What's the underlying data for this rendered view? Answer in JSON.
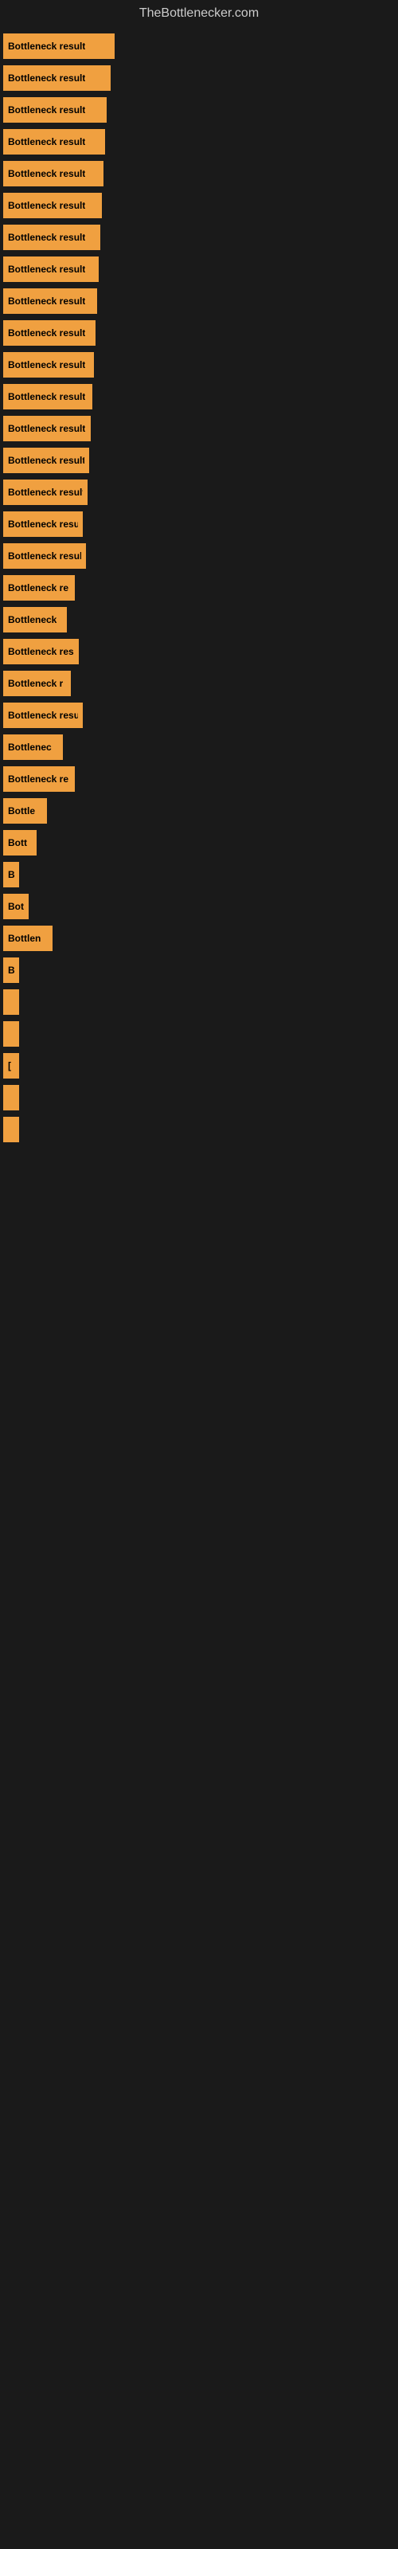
{
  "site": {
    "title": "TheBottlenecker.com"
  },
  "bars": [
    {
      "label": "Bottleneck result",
      "width": 140
    },
    {
      "label": "Bottleneck result",
      "width": 135
    },
    {
      "label": "Bottleneck result",
      "width": 130
    },
    {
      "label": "Bottleneck result",
      "width": 128
    },
    {
      "label": "Bottleneck result",
      "width": 126
    },
    {
      "label": "Bottleneck result",
      "width": 124
    },
    {
      "label": "Bottleneck result",
      "width": 122
    },
    {
      "label": "Bottleneck result",
      "width": 120
    },
    {
      "label": "Bottleneck result",
      "width": 118
    },
    {
      "label": "Bottleneck result",
      "width": 116
    },
    {
      "label": "Bottleneck result",
      "width": 114
    },
    {
      "label": "Bottleneck result",
      "width": 112
    },
    {
      "label": "Bottleneck result",
      "width": 110
    },
    {
      "label": "Bottleneck result",
      "width": 108
    },
    {
      "label": "Bottleneck result",
      "width": 106
    },
    {
      "label": "Bottleneck resu",
      "width": 100
    },
    {
      "label": "Bottleneck result",
      "width": 104
    },
    {
      "label": "Bottleneck re",
      "width": 90
    },
    {
      "label": "Bottleneck",
      "width": 80
    },
    {
      "label": "Bottleneck res",
      "width": 95
    },
    {
      "label": "Bottleneck r",
      "width": 85
    },
    {
      "label": "Bottleneck resu",
      "width": 100
    },
    {
      "label": "Bottlenec",
      "width": 75
    },
    {
      "label": "Bottleneck re",
      "width": 90
    },
    {
      "label": "Bottle",
      "width": 55
    },
    {
      "label": "Bott",
      "width": 42
    },
    {
      "label": "B",
      "width": 18
    },
    {
      "label": "Bot",
      "width": 32
    },
    {
      "label": "Bottlen",
      "width": 62
    },
    {
      "label": "B",
      "width": 16
    },
    {
      "label": "",
      "width": 8
    },
    {
      "label": "",
      "width": 4
    },
    {
      "label": "[",
      "width": 10
    },
    {
      "label": "",
      "width": 6
    },
    {
      "label": "",
      "width": 4
    }
  ]
}
